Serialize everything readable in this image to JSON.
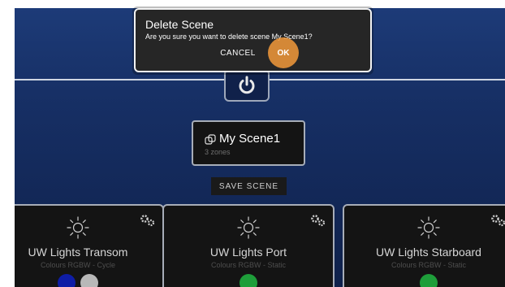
{
  "dialog": {
    "title": "Delete Scene",
    "message": "Are you sure you want to delete scene My Scene1?",
    "cancel_label": "CANCEL",
    "ok_label": "OK"
  },
  "power": {
    "icon": "power-icon"
  },
  "scene": {
    "name": "My Scene1",
    "zones_text": "3 zones",
    "icon": "copy-icon",
    "save_label": "SAVE SCENE"
  },
  "zones": [
    {
      "title": "UW Lights Transom",
      "subtitle": "Colours RGBW - Cycle",
      "icon": "sun-icon",
      "settings_icon": "gears-icon",
      "colors": [
        "#0e1da6",
        "#b8b8b8"
      ]
    },
    {
      "title": "UW Lights Port",
      "subtitle": "Colours RGBW - Static",
      "icon": "sun-icon",
      "settings_icon": "gears-icon",
      "colors": [
        "#1e9e3a"
      ]
    },
    {
      "title": "UW Lights Starboard",
      "subtitle": "Colours RGBW - Static",
      "icon": "sun-icon",
      "settings_icon": "gears-icon",
      "colors": [
        "#1e9e3a"
      ]
    }
  ],
  "theme": {
    "accent": "#f39a3b",
    "background": "#173066",
    "card": "#141414"
  }
}
